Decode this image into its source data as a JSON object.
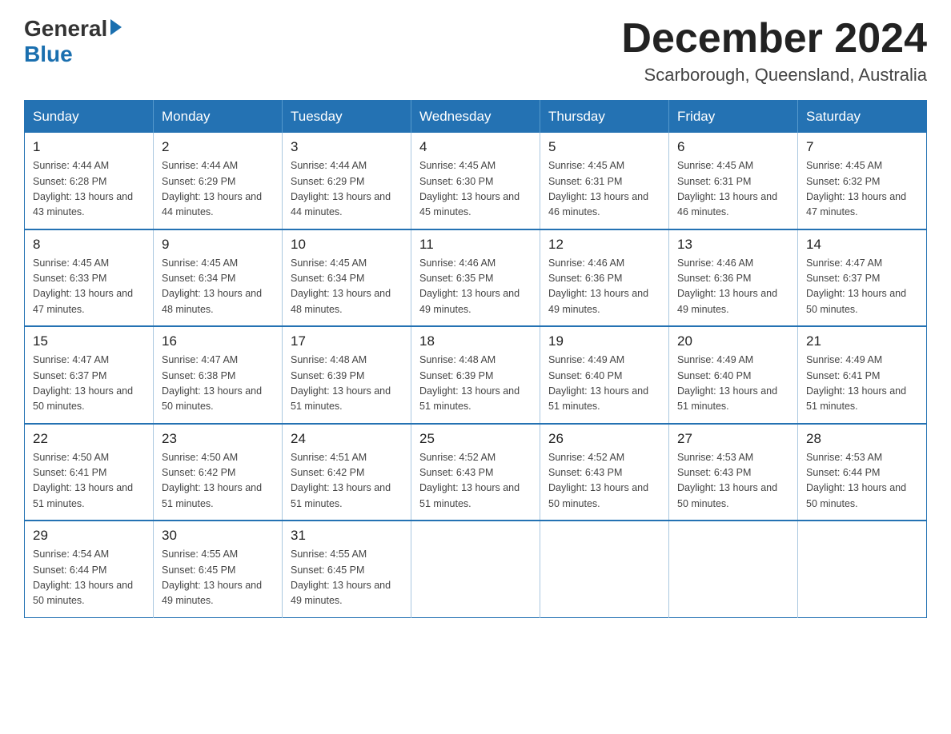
{
  "header": {
    "logo_general": "General",
    "logo_blue": "Blue",
    "main_title": "December 2024",
    "subtitle": "Scarborough, Queensland, Australia"
  },
  "days_of_week": [
    "Sunday",
    "Monday",
    "Tuesday",
    "Wednesday",
    "Thursday",
    "Friday",
    "Saturday"
  ],
  "weeks": [
    [
      {
        "day": "1",
        "sunrise": "Sunrise: 4:44 AM",
        "sunset": "Sunset: 6:28 PM",
        "daylight": "Daylight: 13 hours and 43 minutes."
      },
      {
        "day": "2",
        "sunrise": "Sunrise: 4:44 AM",
        "sunset": "Sunset: 6:29 PM",
        "daylight": "Daylight: 13 hours and 44 minutes."
      },
      {
        "day": "3",
        "sunrise": "Sunrise: 4:44 AM",
        "sunset": "Sunset: 6:29 PM",
        "daylight": "Daylight: 13 hours and 44 minutes."
      },
      {
        "day": "4",
        "sunrise": "Sunrise: 4:45 AM",
        "sunset": "Sunset: 6:30 PM",
        "daylight": "Daylight: 13 hours and 45 minutes."
      },
      {
        "day": "5",
        "sunrise": "Sunrise: 4:45 AM",
        "sunset": "Sunset: 6:31 PM",
        "daylight": "Daylight: 13 hours and 46 minutes."
      },
      {
        "day": "6",
        "sunrise": "Sunrise: 4:45 AM",
        "sunset": "Sunset: 6:31 PM",
        "daylight": "Daylight: 13 hours and 46 minutes."
      },
      {
        "day": "7",
        "sunrise": "Sunrise: 4:45 AM",
        "sunset": "Sunset: 6:32 PM",
        "daylight": "Daylight: 13 hours and 47 minutes."
      }
    ],
    [
      {
        "day": "8",
        "sunrise": "Sunrise: 4:45 AM",
        "sunset": "Sunset: 6:33 PM",
        "daylight": "Daylight: 13 hours and 47 minutes."
      },
      {
        "day": "9",
        "sunrise": "Sunrise: 4:45 AM",
        "sunset": "Sunset: 6:34 PM",
        "daylight": "Daylight: 13 hours and 48 minutes."
      },
      {
        "day": "10",
        "sunrise": "Sunrise: 4:45 AM",
        "sunset": "Sunset: 6:34 PM",
        "daylight": "Daylight: 13 hours and 48 minutes."
      },
      {
        "day": "11",
        "sunrise": "Sunrise: 4:46 AM",
        "sunset": "Sunset: 6:35 PM",
        "daylight": "Daylight: 13 hours and 49 minutes."
      },
      {
        "day": "12",
        "sunrise": "Sunrise: 4:46 AM",
        "sunset": "Sunset: 6:36 PM",
        "daylight": "Daylight: 13 hours and 49 minutes."
      },
      {
        "day": "13",
        "sunrise": "Sunrise: 4:46 AM",
        "sunset": "Sunset: 6:36 PM",
        "daylight": "Daylight: 13 hours and 49 minutes."
      },
      {
        "day": "14",
        "sunrise": "Sunrise: 4:47 AM",
        "sunset": "Sunset: 6:37 PM",
        "daylight": "Daylight: 13 hours and 50 minutes."
      }
    ],
    [
      {
        "day": "15",
        "sunrise": "Sunrise: 4:47 AM",
        "sunset": "Sunset: 6:37 PM",
        "daylight": "Daylight: 13 hours and 50 minutes."
      },
      {
        "day": "16",
        "sunrise": "Sunrise: 4:47 AM",
        "sunset": "Sunset: 6:38 PM",
        "daylight": "Daylight: 13 hours and 50 minutes."
      },
      {
        "day": "17",
        "sunrise": "Sunrise: 4:48 AM",
        "sunset": "Sunset: 6:39 PM",
        "daylight": "Daylight: 13 hours and 51 minutes."
      },
      {
        "day": "18",
        "sunrise": "Sunrise: 4:48 AM",
        "sunset": "Sunset: 6:39 PM",
        "daylight": "Daylight: 13 hours and 51 minutes."
      },
      {
        "day": "19",
        "sunrise": "Sunrise: 4:49 AM",
        "sunset": "Sunset: 6:40 PM",
        "daylight": "Daylight: 13 hours and 51 minutes."
      },
      {
        "day": "20",
        "sunrise": "Sunrise: 4:49 AM",
        "sunset": "Sunset: 6:40 PM",
        "daylight": "Daylight: 13 hours and 51 minutes."
      },
      {
        "day": "21",
        "sunrise": "Sunrise: 4:49 AM",
        "sunset": "Sunset: 6:41 PM",
        "daylight": "Daylight: 13 hours and 51 minutes."
      }
    ],
    [
      {
        "day": "22",
        "sunrise": "Sunrise: 4:50 AM",
        "sunset": "Sunset: 6:41 PM",
        "daylight": "Daylight: 13 hours and 51 minutes."
      },
      {
        "day": "23",
        "sunrise": "Sunrise: 4:50 AM",
        "sunset": "Sunset: 6:42 PM",
        "daylight": "Daylight: 13 hours and 51 minutes."
      },
      {
        "day": "24",
        "sunrise": "Sunrise: 4:51 AM",
        "sunset": "Sunset: 6:42 PM",
        "daylight": "Daylight: 13 hours and 51 minutes."
      },
      {
        "day": "25",
        "sunrise": "Sunrise: 4:52 AM",
        "sunset": "Sunset: 6:43 PM",
        "daylight": "Daylight: 13 hours and 51 minutes."
      },
      {
        "day": "26",
        "sunrise": "Sunrise: 4:52 AM",
        "sunset": "Sunset: 6:43 PM",
        "daylight": "Daylight: 13 hours and 50 minutes."
      },
      {
        "day": "27",
        "sunrise": "Sunrise: 4:53 AM",
        "sunset": "Sunset: 6:43 PM",
        "daylight": "Daylight: 13 hours and 50 minutes."
      },
      {
        "day": "28",
        "sunrise": "Sunrise: 4:53 AM",
        "sunset": "Sunset: 6:44 PM",
        "daylight": "Daylight: 13 hours and 50 minutes."
      }
    ],
    [
      {
        "day": "29",
        "sunrise": "Sunrise: 4:54 AM",
        "sunset": "Sunset: 6:44 PM",
        "daylight": "Daylight: 13 hours and 50 minutes."
      },
      {
        "day": "30",
        "sunrise": "Sunrise: 4:55 AM",
        "sunset": "Sunset: 6:45 PM",
        "daylight": "Daylight: 13 hours and 49 minutes."
      },
      {
        "day": "31",
        "sunrise": "Sunrise: 4:55 AM",
        "sunset": "Sunset: 6:45 PM",
        "daylight": "Daylight: 13 hours and 49 minutes."
      },
      null,
      null,
      null,
      null
    ]
  ]
}
